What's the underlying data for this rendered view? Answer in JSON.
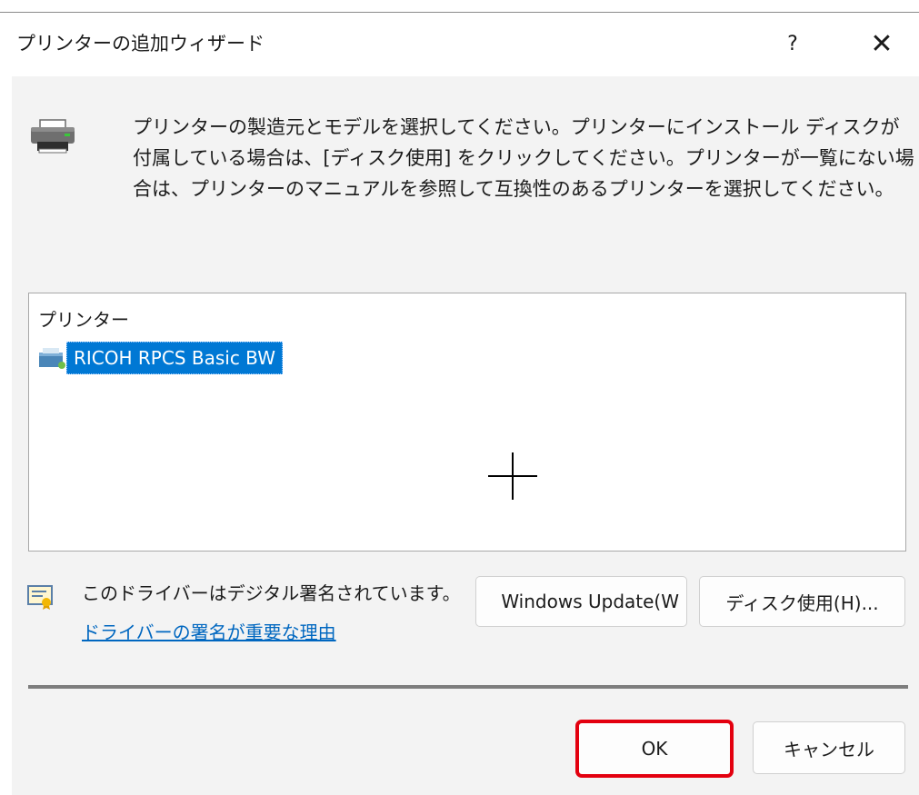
{
  "window": {
    "title": "プリンターの追加ウィザード",
    "help_label": "?",
    "close_label": "✕"
  },
  "intro": {
    "text": "プリンターの製造元とモデルを選択してください。プリンターにインストール ディスクが付属している場合は、[ディスク使用] をクリックしてください。プリンターが一覧にない場合は、プリンターのマニュアルを参照して互換性のあるプリンターを選択してください。"
  },
  "printer_list": {
    "header": "プリンター",
    "items": [
      {
        "label": "RICOH RPCS Basic BW",
        "selected": true
      }
    ]
  },
  "signature": {
    "status_text": "このドライバーはデジタル署名されています。",
    "link_text": "ドライバーの署名が重要な理由"
  },
  "buttons": {
    "windows_update_label": "Windows Update(W",
    "have_disk_label": "ディスク使用(H)...",
    "ok_label": "OK",
    "cancel_label": "キャンセル"
  },
  "icons": {
    "printer": "printer-icon",
    "driver_item": "printer-driver-icon",
    "signed": "certificate-icon",
    "help": "help-icon",
    "close": "close-icon"
  },
  "colors": {
    "selection": "#0078d4",
    "link": "#0067c0",
    "highlight_border": "#e3000f"
  }
}
